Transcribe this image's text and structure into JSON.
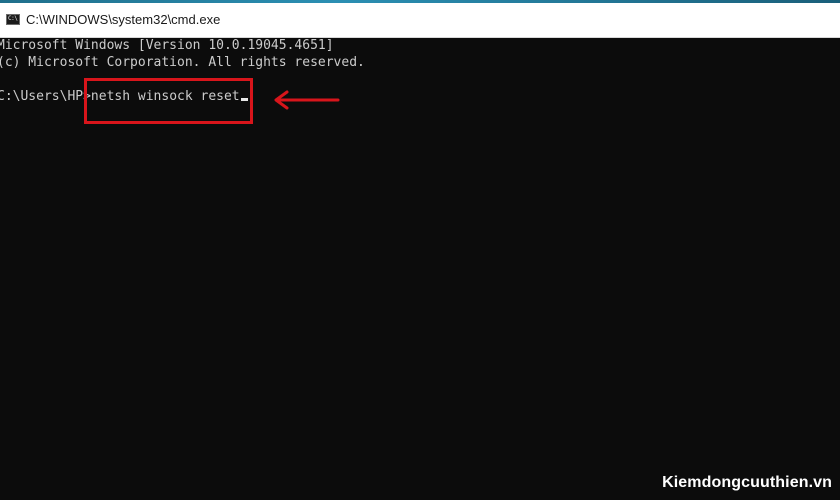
{
  "window": {
    "title": "C:\\WINDOWS\\system32\\cmd.exe",
    "icon": "cmd-icon",
    "icon_glyph": "C:\\"
  },
  "terminal": {
    "lines": [
      "Microsoft Windows [Version 10.0.19045.4651]",
      "(c) Microsoft Corporation. All rights reserved."
    ],
    "prompt": "C:\\Users\\HP>",
    "command": "netsh winsock reset"
  },
  "annotation": {
    "highlight_color": "#d8151b",
    "arrow_icon": "arrow-left-icon"
  },
  "watermark": {
    "text": "Kiemdongcuuthien.vn"
  },
  "colors": {
    "terminal_bg": "#0c0c0c",
    "terminal_text": "#cccccc",
    "titlebar_bg": "#ffffff"
  }
}
